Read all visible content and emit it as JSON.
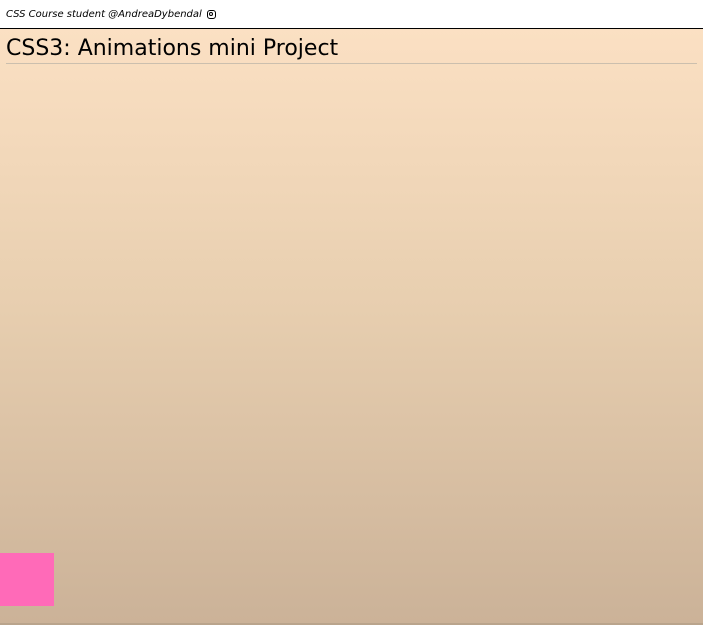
{
  "topbar": {
    "credit_text": "CSS Course student @AndreaDybendal",
    "icon": "instagram-icon"
  },
  "main": {
    "title": "CSS3: Animations mini Project"
  },
  "colors": {
    "background_top": "#fbe0c3",
    "background_bottom": "#cbb298",
    "animated_box": "#ff6ab8"
  }
}
